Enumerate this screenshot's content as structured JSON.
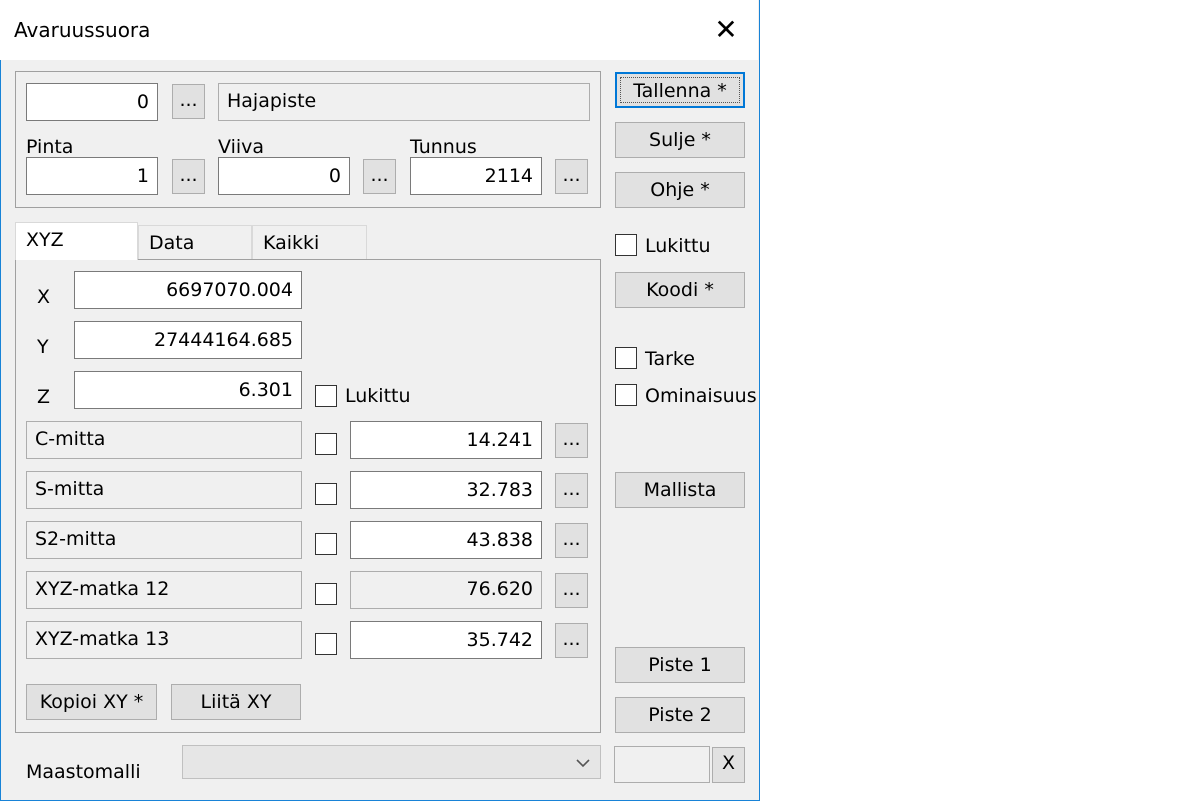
{
  "window": {
    "title": "Avaruussuora",
    "close_glyph": "✕"
  },
  "top_group": {
    "code_value": "0",
    "browse_label": "...",
    "code_name": "Hajapiste",
    "pinta_label": "Pinta",
    "pinta_value": "1",
    "viiva_label": "Viiva",
    "viiva_value": "0",
    "tunnus_label": "Tunnus",
    "tunnus_value": "2114"
  },
  "tabs": [
    {
      "label": "XYZ",
      "active": true
    },
    {
      "label": "Data",
      "active": false
    },
    {
      "label": "Kaikki",
      "active": false
    }
  ],
  "xyz": {
    "x_label": "X",
    "x_value": "6697070.004",
    "y_label": "Y",
    "y_value": "27444164.685",
    "z_label": "Z",
    "z_value": "6.301",
    "z_lock_label": "Lukittu",
    "measures": [
      {
        "label": "C-mitta",
        "value": "14.241",
        "checked": false,
        "editable": true
      },
      {
        "label": "S-mitta",
        "value": "32.783",
        "checked": false,
        "editable": true
      },
      {
        "label": "S2-mitta",
        "value": "43.838",
        "checked": false,
        "editable": true
      },
      {
        "label": "XYZ-matka 12",
        "value": "76.620",
        "checked": false,
        "editable": false
      },
      {
        "label": "XYZ-matka 13",
        "value": "35.742",
        "checked": false,
        "editable": true
      }
    ],
    "copy_xy_label": "Kopioi XY *",
    "paste_xy_label": "Liitä XY"
  },
  "sidebar": {
    "save_label": "Tallenna *",
    "close_label": "Sulje *",
    "help_label": "Ohje *",
    "locked_label": "Lukittu",
    "code_label": "Koodi *",
    "tarke_label": "Tarke",
    "ominaisuus_label": "Ominaisuus",
    "from_model_label": "Mallista",
    "point1_label": "Piste 1",
    "point2_label": "Piste 2",
    "clear_label": "X"
  },
  "footer": {
    "terrain_model_label": "Maastomalli",
    "terrain_model_value": ""
  },
  "colors": {
    "accent": "#0078d7",
    "window_border": "#1883d7",
    "face": "#f0f0f0",
    "button": "#e1e1e1"
  }
}
